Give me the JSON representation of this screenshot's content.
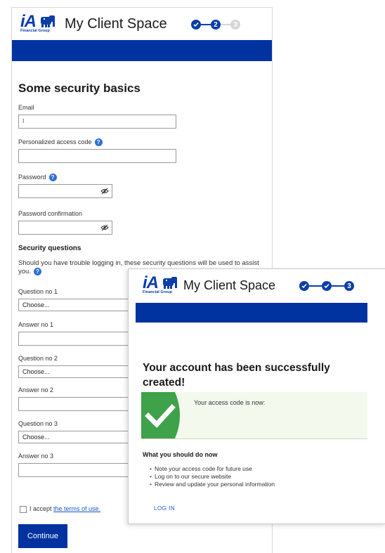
{
  "colors": {
    "brand_blue": "#0033a0",
    "logo_blue": "#0b3ea8",
    "success_green": "#3fa14a",
    "help_blue": "#2e6fd8"
  },
  "left": {
    "logo": {
      "text": "iA",
      "subtext": "Financial Group"
    },
    "title": "My Client Space",
    "steps": {
      "step2": "2",
      "step3": "3"
    },
    "heading": "Some security basics",
    "email": {
      "label": "Email",
      "value": "I"
    },
    "access_code": {
      "label": "Personalized access code",
      "value": ""
    },
    "password": {
      "label": "Password",
      "value": ""
    },
    "password_confirm": {
      "label": "Password confirmation",
      "value": ""
    },
    "security": {
      "heading": "Security questions",
      "intro": "Should you have trouble logging in, these security questions will be used to assist you.",
      "question1_label": "Question no 1",
      "question1_value": "Choose...",
      "answer1_label": "Answer no 1",
      "question2_label": "Question no 2",
      "question2_value": "Choose...",
      "answer2_label": "Answer no 2",
      "question3_label": "Question no 3",
      "question3_value": "Choose...",
      "answer3_label": "Answer no 3"
    },
    "terms": {
      "prefix": "I accept ",
      "link": "the terms of use."
    },
    "continue_label": "Continue",
    "help_glyph": "?"
  },
  "right": {
    "logo": {
      "text": "iA",
      "subtext": "Financial Group"
    },
    "title": "My Client Space",
    "steps": {
      "step3": "3"
    },
    "heading": "Your account has been successfully created!",
    "success_text": "Your access code is now:",
    "next_heading": "What you should do now",
    "next_items": [
      "Note your access code for future use",
      "Log on to our secure website",
      "Review and update your personal information"
    ],
    "login_label": "LOG IN"
  }
}
